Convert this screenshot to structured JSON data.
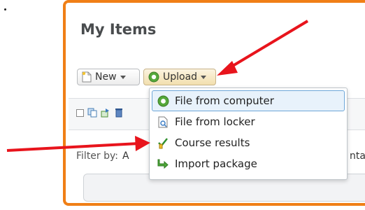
{
  "page": {
    "title": "My Items"
  },
  "toolbar": {
    "new_label": "New",
    "upload_label": "Upload"
  },
  "upload_menu": {
    "items": [
      {
        "label": "File from computer",
        "icon": "green-up-circle-icon",
        "active": true
      },
      {
        "label": "File from locker",
        "icon": "locker-document-icon",
        "active": false
      },
      {
        "label": "Course results",
        "icon": "checklist-pencil-icon",
        "active": false
      },
      {
        "label": "Import package",
        "icon": "green-import-arrow-icon",
        "active": false
      }
    ]
  },
  "filter": {
    "label": "Filter by:",
    "value": "A"
  },
  "right_partial_text": "nta",
  "colors": {
    "frame_border": "#f07f16",
    "annotation_arrow": "#e8141c",
    "menu_highlight": "#e8f2fb",
    "menu_highlight_border": "#6ea7d8"
  }
}
